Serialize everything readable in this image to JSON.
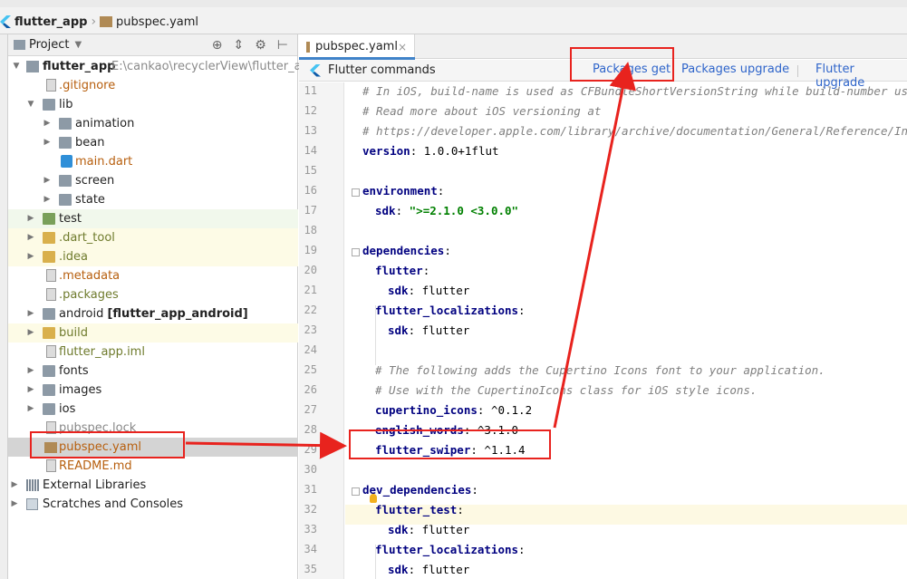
{
  "breadcrumb": {
    "project": "flutter_app",
    "file": "pubspec.yaml"
  },
  "project_panel": {
    "title": "Project",
    "tree": [
      {
        "label": "flutter_app",
        "path": "E:\\cankao\\recyclerView\\flutter_app",
        "icon": "folder-icon"
      },
      {
        "label": ".gitignore",
        "icon": "file-icon"
      },
      {
        "label": "lib",
        "icon": "folder-icon"
      },
      {
        "label": "animation",
        "icon": "folder-icon"
      },
      {
        "label": "bean",
        "icon": "folder-icon"
      },
      {
        "label": "main.dart",
        "icon": "dart-file-icon"
      },
      {
        "label": "screen",
        "icon": "folder-icon"
      },
      {
        "label": "state",
        "icon": "folder-icon"
      },
      {
        "label": "test",
        "icon": "folder-icon"
      },
      {
        "label": ".dart_tool",
        "icon": "folder-icon"
      },
      {
        "label": ".idea",
        "icon": "folder-icon"
      },
      {
        "label": ".metadata",
        "icon": "file-icon"
      },
      {
        "label": ".packages",
        "icon": "file-icon"
      },
      {
        "label": "android",
        "suffix": "[flutter_app_android]",
        "icon": "folder-icon"
      },
      {
        "label": "build",
        "icon": "folder-icon"
      },
      {
        "label": "flutter_app.iml",
        "icon": "file-icon"
      },
      {
        "label": "fonts",
        "icon": "folder-icon"
      },
      {
        "label": "images",
        "icon": "folder-icon"
      },
      {
        "label": "ios",
        "icon": "folder-icon"
      },
      {
        "label": "pubspec.lock",
        "icon": "file-icon"
      },
      {
        "label": "pubspec.yaml",
        "icon": "yaml-file-icon"
      },
      {
        "label": "README.md",
        "icon": "file-icon"
      },
      {
        "label": "External Libraries",
        "icon": "library-icon"
      },
      {
        "label": "Scratches and Consoles",
        "icon": "scratches-icon"
      }
    ]
  },
  "editor": {
    "tab_label": "pubspec.yaml",
    "flutter_commands": {
      "title": "Flutter commands",
      "packages_get": "Packages get",
      "packages_upgrade": "Packages upgrade",
      "flutter_upgrade": "Flutter upgrade"
    },
    "lines": [
      {
        "n": "11",
        "text": "# In iOS, build-name is used as CFBundleShortVersionString while build-number used as"
      },
      {
        "n": "12",
        "text": "# Read more about iOS versioning at"
      },
      {
        "n": "13",
        "text": "# https://developer.apple.com/library/archive/documentation/General/Reference/InfoPlis"
      },
      {
        "n": "14",
        "key": "version",
        "value": "1.0.0+1flut"
      },
      {
        "n": "15",
        "text": ""
      },
      {
        "n": "16",
        "key": "environment",
        "value": ""
      },
      {
        "n": "17",
        "key": "sdk",
        "value": "\">=2.1.0 <3.0.0\""
      },
      {
        "n": "18",
        "text": ""
      },
      {
        "n": "19",
        "key": "dependencies",
        "value": ""
      },
      {
        "n": "20",
        "key": "flutter",
        "value": ""
      },
      {
        "n": "21",
        "key": "sdk",
        "value": "flutter"
      },
      {
        "n": "22",
        "key": "flutter_localizations",
        "value": ""
      },
      {
        "n": "23",
        "key": "sdk",
        "value": "flutter"
      },
      {
        "n": "24",
        "text": ""
      },
      {
        "n": "25",
        "text": "# The following adds the Cupertino Icons font to your application."
      },
      {
        "n": "26",
        "text": "# Use with the CupertinoIcons class for iOS style icons."
      },
      {
        "n": "27",
        "key": "cupertino_icons",
        "value": "^0.1.2"
      },
      {
        "n": "28",
        "key": "english_words",
        "value": "^3.1.0"
      },
      {
        "n": "29",
        "key": "flutter_swiper",
        "value": "^1.1.4"
      },
      {
        "n": "30",
        "text": ""
      },
      {
        "n": "31",
        "key": "dev_dependencies",
        "value": ""
      },
      {
        "n": "32",
        "key": "flutter_test",
        "value": ""
      },
      {
        "n": "33",
        "key": "sdk",
        "value": "flutter"
      },
      {
        "n": "34",
        "key": "flutter_localizations",
        "value": ""
      },
      {
        "n": "35",
        "key": "sdk",
        "value": "flutter"
      }
    ]
  },
  "colors": {
    "annotation_red": "#e8231e",
    "link_blue": "#2f65ca"
  }
}
